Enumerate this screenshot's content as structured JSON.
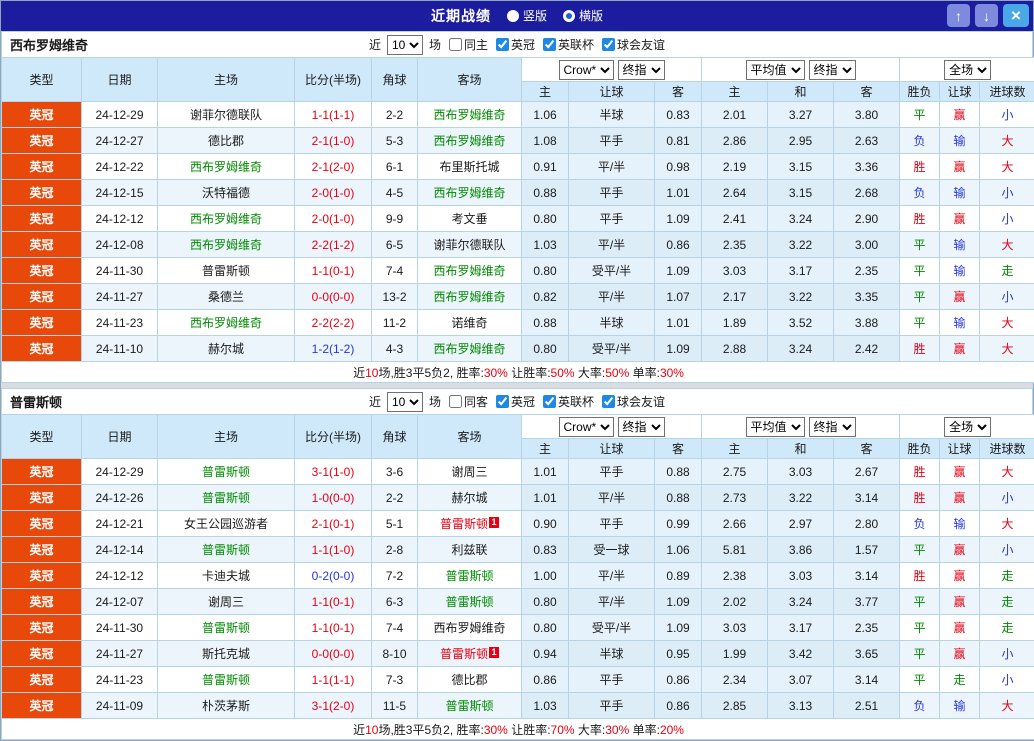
{
  "topbar": {
    "title": "近期战绩",
    "radios": [
      {
        "label": "竖版",
        "checked": false
      },
      {
        "label": "横版",
        "checked": true
      }
    ],
    "up_icon": "↑",
    "down_icon": "↓",
    "close_icon": "×"
  },
  "labels": {
    "near": "近",
    "unit": "场"
  },
  "columns": {
    "type": "类型",
    "date": "日期",
    "home": "主场",
    "score": "比分(半场)",
    "corners": "角球",
    "away": "客场",
    "sub_odds": [
      "主",
      "让球",
      "客"
    ],
    "sub_avg": [
      "主",
      "和",
      "客"
    ],
    "sub_result": [
      "胜负",
      "让球",
      "进球数"
    ]
  },
  "selects": {
    "odds_source": "Crow*",
    "odds_final": "终指",
    "avg_source": "平均值",
    "avg_final": "终指",
    "scope": "全场"
  },
  "colors": {
    "accent_red": "#e60012",
    "accent_green": "#018a01",
    "accent_blue": "#2637d8",
    "league_bg": "#e8490a",
    "header_bg": "#cfe9fa",
    "titlebar_bg": "#1c1c9e"
  },
  "sections": [
    {
      "team": "西布罗姆维奇",
      "filter": {
        "count": "10",
        "checkboxes": [
          {
            "label": "同主",
            "checked": false
          },
          {
            "label": "英冠",
            "checked": true
          },
          {
            "label": "英联杯",
            "checked": true
          },
          {
            "label": "球会友谊",
            "checked": true
          }
        ]
      },
      "rows": [
        {
          "league": "英冠",
          "date": "24-12-29",
          "home": "谢菲尔德联队",
          "home_color": "black",
          "home_badge": "",
          "score": "1-1(1-1)",
          "score_color": "red",
          "corners": "2-2",
          "away": "西布罗姆维奇",
          "away_color": "green",
          "away_badge": "",
          "odds": [
            "1.06",
            "半球",
            "0.83"
          ],
          "avg": [
            "2.01",
            "3.27",
            "3.80"
          ],
          "results": [
            {
              "text": "平",
              "color": "green"
            },
            {
              "text": "赢",
              "color": "red"
            },
            {
              "text": "小",
              "color": "blue"
            }
          ]
        },
        {
          "league": "英冠",
          "date": "24-12-27",
          "home": "德比郡",
          "home_color": "black",
          "home_badge": "",
          "score": "2-1(1-0)",
          "score_color": "red",
          "corners": "5-3",
          "away": "西布罗姆维奇",
          "away_color": "green",
          "away_badge": "",
          "odds": [
            "1.08",
            "平手",
            "0.81"
          ],
          "avg": [
            "2.86",
            "2.95",
            "2.63"
          ],
          "results": [
            {
              "text": "负",
              "color": "blue"
            },
            {
              "text": "输",
              "color": "blue"
            },
            {
              "text": "大",
              "color": "red"
            }
          ]
        },
        {
          "league": "英冠",
          "date": "24-12-22",
          "home": "西布罗姆维奇",
          "home_color": "green",
          "home_badge": "",
          "score": "2-1(2-0)",
          "score_color": "red",
          "corners": "6-1",
          "away": "布里斯托城",
          "away_color": "black",
          "away_badge": "",
          "odds": [
            "0.91",
            "平/半",
            "0.98"
          ],
          "avg": [
            "2.19",
            "3.15",
            "3.36"
          ],
          "results": [
            {
              "text": "胜",
              "color": "red"
            },
            {
              "text": "赢",
              "color": "red"
            },
            {
              "text": "大",
              "color": "red"
            }
          ]
        },
        {
          "league": "英冠",
          "date": "24-12-15",
          "home": "沃特福德",
          "home_color": "black",
          "home_badge": "",
          "score": "2-0(1-0)",
          "score_color": "red",
          "corners": "4-5",
          "away": "西布罗姆维奇",
          "away_color": "green",
          "away_badge": "",
          "odds": [
            "0.88",
            "平手",
            "1.01"
          ],
          "avg": [
            "2.64",
            "3.15",
            "2.68"
          ],
          "results": [
            {
              "text": "负",
              "color": "blue"
            },
            {
              "text": "输",
              "color": "blue"
            },
            {
              "text": "小",
              "color": "blue"
            }
          ]
        },
        {
          "league": "英冠",
          "date": "24-12-12",
          "home": "西布罗姆维奇",
          "home_color": "green",
          "home_badge": "",
          "score": "2-0(1-0)",
          "score_color": "red",
          "corners": "9-9",
          "away": "考文垂",
          "away_color": "black",
          "away_badge": "",
          "odds": [
            "0.80",
            "平手",
            "1.09"
          ],
          "avg": [
            "2.41",
            "3.24",
            "2.90"
          ],
          "results": [
            {
              "text": "胜",
              "color": "red"
            },
            {
              "text": "赢",
              "color": "red"
            },
            {
              "text": "小",
              "color": "blue"
            }
          ]
        },
        {
          "league": "英冠",
          "date": "24-12-08",
          "home": "西布罗姆维奇",
          "home_color": "green",
          "home_badge": "",
          "score": "2-2(1-2)",
          "score_color": "red",
          "corners": "6-5",
          "away": "谢菲尔德联队",
          "away_color": "black",
          "away_badge": "",
          "odds": [
            "1.03",
            "平/半",
            "0.86"
          ],
          "avg": [
            "2.35",
            "3.22",
            "3.00"
          ],
          "results": [
            {
              "text": "平",
              "color": "green"
            },
            {
              "text": "输",
              "color": "blue"
            },
            {
              "text": "大",
              "color": "red"
            }
          ]
        },
        {
          "league": "英冠",
          "date": "24-11-30",
          "home": "普雷斯顿",
          "home_color": "black",
          "home_badge": "",
          "score": "1-1(0-1)",
          "score_color": "red",
          "corners": "7-4",
          "away": "西布罗姆维奇",
          "away_color": "green",
          "away_badge": "",
          "odds": [
            "0.80",
            "受平/半",
            "1.09"
          ],
          "avg": [
            "3.03",
            "3.17",
            "2.35"
          ],
          "results": [
            {
              "text": "平",
              "color": "green"
            },
            {
              "text": "输",
              "color": "blue"
            },
            {
              "text": "走",
              "color": "green"
            }
          ]
        },
        {
          "league": "英冠",
          "date": "24-11-27",
          "home": "桑德兰",
          "home_color": "black",
          "home_badge": "",
          "score": "0-0(0-0)",
          "score_color": "red",
          "corners": "13-2",
          "away": "西布罗姆维奇",
          "away_color": "green",
          "away_badge": "",
          "odds": [
            "0.82",
            "平/半",
            "1.07"
          ],
          "avg": [
            "2.17",
            "3.22",
            "3.35"
          ],
          "results": [
            {
              "text": "平",
              "color": "green"
            },
            {
              "text": "赢",
              "color": "red"
            },
            {
              "text": "小",
              "color": "blue"
            }
          ]
        },
        {
          "league": "英冠",
          "date": "24-11-23",
          "home": "西布罗姆维奇",
          "home_color": "green",
          "home_badge": "",
          "score": "2-2(2-2)",
          "score_color": "red",
          "corners": "11-2",
          "away": "诺维奇",
          "away_color": "black",
          "away_badge": "",
          "odds": [
            "0.88",
            "半球",
            "1.01"
          ],
          "avg": [
            "1.89",
            "3.52",
            "3.88"
          ],
          "results": [
            {
              "text": "平",
              "color": "green"
            },
            {
              "text": "输",
              "color": "blue"
            },
            {
              "text": "大",
              "color": "red"
            }
          ]
        },
        {
          "league": "英冠",
          "date": "24-11-10",
          "home": "赫尔城",
          "home_color": "black",
          "home_badge": "",
          "score": "1-2(1-2)",
          "score_color": "blue",
          "corners": "4-3",
          "away": "西布罗姆维奇",
          "away_color": "green",
          "away_badge": "",
          "odds": [
            "0.80",
            "受平/半",
            "1.09"
          ],
          "avg": [
            "2.88",
            "3.24",
            "2.42"
          ],
          "results": [
            {
              "text": "胜",
              "color": "red"
            },
            {
              "text": "赢",
              "color": "red"
            },
            {
              "text": "大",
              "color": "red"
            }
          ]
        }
      ],
      "summary": [
        {
          "text": "近",
          "color": "black"
        },
        {
          "text": "10",
          "color": "red"
        },
        {
          "text": "场,胜3平5负2, 胜率:",
          "color": "black"
        },
        {
          "text": "30%",
          "color": "red"
        },
        {
          "text": " 让胜率:",
          "color": "black"
        },
        {
          "text": "50%",
          "color": "red"
        },
        {
          "text": " 大率:",
          "color": "black"
        },
        {
          "text": "50%",
          "color": "red"
        },
        {
          "text": " 单率:",
          "color": "black"
        },
        {
          "text": "30%",
          "color": "red"
        }
      ]
    },
    {
      "team": "普雷斯顿",
      "filter": {
        "count": "10",
        "checkboxes": [
          {
            "label": "同客",
            "checked": false
          },
          {
            "label": "英冠",
            "checked": true
          },
          {
            "label": "英联杯",
            "checked": true
          },
          {
            "label": "球会友谊",
            "checked": true
          }
        ]
      },
      "rows": [
        {
          "league": "英冠",
          "date": "24-12-29",
          "home": "普雷斯顿",
          "home_color": "green",
          "home_badge": "",
          "score": "3-1(1-0)",
          "score_color": "red",
          "corners": "3-6",
          "away": "谢周三",
          "away_color": "black",
          "away_badge": "",
          "odds": [
            "1.01",
            "平手",
            "0.88"
          ],
          "avg": [
            "2.75",
            "3.03",
            "2.67"
          ],
          "results": [
            {
              "text": "胜",
              "color": "red"
            },
            {
              "text": "赢",
              "color": "red"
            },
            {
              "text": "大",
              "color": "red"
            }
          ]
        },
        {
          "league": "英冠",
          "date": "24-12-26",
          "home": "普雷斯顿",
          "home_color": "green",
          "home_badge": "",
          "score": "1-0(0-0)",
          "score_color": "red",
          "corners": "2-2",
          "away": "赫尔城",
          "away_color": "black",
          "away_badge": "",
          "odds": [
            "1.01",
            "平/半",
            "0.88"
          ],
          "avg": [
            "2.73",
            "3.22",
            "3.14"
          ],
          "results": [
            {
              "text": "胜",
              "color": "red"
            },
            {
              "text": "赢",
              "color": "red"
            },
            {
              "text": "小",
              "color": "blue"
            }
          ]
        },
        {
          "league": "英冠",
          "date": "24-12-21",
          "home": "女王公园巡游者",
          "home_color": "black",
          "home_badge": "",
          "score": "2-1(0-1)",
          "score_color": "red",
          "corners": "5-1",
          "away": "普雷斯顿",
          "away_color": "red",
          "away_badge": "1",
          "odds": [
            "0.90",
            "平手",
            "0.99"
          ],
          "avg": [
            "2.66",
            "2.97",
            "2.80"
          ],
          "results": [
            {
              "text": "负",
              "color": "blue"
            },
            {
              "text": "输",
              "color": "blue"
            },
            {
              "text": "大",
              "color": "red"
            }
          ]
        },
        {
          "league": "英冠",
          "date": "24-12-14",
          "home": "普雷斯顿",
          "home_color": "green",
          "home_badge": "",
          "score": "1-1(1-0)",
          "score_color": "red",
          "corners": "2-8",
          "away": "利兹联",
          "away_color": "black",
          "away_badge": "",
          "odds": [
            "0.83",
            "受一球",
            "1.06"
          ],
          "avg": [
            "5.81",
            "3.86",
            "1.57"
          ],
          "results": [
            {
              "text": "平",
              "color": "green"
            },
            {
              "text": "赢",
              "color": "red"
            },
            {
              "text": "小",
              "color": "blue"
            }
          ]
        },
        {
          "league": "英冠",
          "date": "24-12-12",
          "home": "卡迪夫城",
          "home_color": "black",
          "home_badge": "",
          "score": "0-2(0-0)",
          "score_color": "blue",
          "corners": "7-2",
          "away": "普雷斯顿",
          "away_color": "green",
          "away_badge": "",
          "odds": [
            "1.00",
            "平/半",
            "0.89"
          ],
          "avg": [
            "2.38",
            "3.03",
            "3.14"
          ],
          "results": [
            {
              "text": "胜",
              "color": "red"
            },
            {
              "text": "赢",
              "color": "red"
            },
            {
              "text": "走",
              "color": "green"
            }
          ]
        },
        {
          "league": "英冠",
          "date": "24-12-07",
          "home": "谢周三",
          "home_color": "black",
          "home_badge": "",
          "score": "1-1(0-1)",
          "score_color": "red",
          "corners": "6-3",
          "away": "普雷斯顿",
          "away_color": "green",
          "away_badge": "",
          "odds": [
            "0.80",
            "平/半",
            "1.09"
          ],
          "avg": [
            "2.02",
            "3.24",
            "3.77"
          ],
          "results": [
            {
              "text": "平",
              "color": "green"
            },
            {
              "text": "赢",
              "color": "red"
            },
            {
              "text": "走",
              "color": "green"
            }
          ]
        },
        {
          "league": "英冠",
          "date": "24-11-30",
          "home": "普雷斯顿",
          "home_color": "green",
          "home_badge": "",
          "score": "1-1(0-1)",
          "score_color": "red",
          "corners": "7-4",
          "away": "西布罗姆维奇",
          "away_color": "black",
          "away_badge": "",
          "odds": [
            "0.80",
            "受平/半",
            "1.09"
          ],
          "avg": [
            "3.03",
            "3.17",
            "2.35"
          ],
          "results": [
            {
              "text": "平",
              "color": "green"
            },
            {
              "text": "赢",
              "color": "red"
            },
            {
              "text": "走",
              "color": "green"
            }
          ]
        },
        {
          "league": "英冠",
          "date": "24-11-27",
          "home": "斯托克城",
          "home_color": "black",
          "home_badge": "",
          "score": "0-0(0-0)",
          "score_color": "red",
          "corners": "8-10",
          "away": "普雷斯顿",
          "away_color": "red",
          "away_badge": "1",
          "odds": [
            "0.94",
            "半球",
            "0.95"
          ],
          "avg": [
            "1.99",
            "3.42",
            "3.65"
          ],
          "results": [
            {
              "text": "平",
              "color": "green"
            },
            {
              "text": "赢",
              "color": "red"
            },
            {
              "text": "小",
              "color": "blue"
            }
          ]
        },
        {
          "league": "英冠",
          "date": "24-11-23",
          "home": "普雷斯顿",
          "home_color": "green",
          "home_badge": "",
          "score": "1-1(1-1)",
          "score_color": "red",
          "corners": "7-3",
          "away": "德比郡",
          "away_color": "black",
          "away_badge": "",
          "odds": [
            "0.86",
            "平手",
            "0.86"
          ],
          "avg": [
            "2.34",
            "3.07",
            "3.14"
          ],
          "results": [
            {
              "text": "平",
              "color": "green"
            },
            {
              "text": "走",
              "color": "green"
            },
            {
              "text": "小",
              "color": "blue"
            }
          ]
        },
        {
          "league": "英冠",
          "date": "24-11-09",
          "home": "朴茨茅斯",
          "home_color": "black",
          "home_badge": "",
          "score": "3-1(2-0)",
          "score_color": "red",
          "corners": "11-5",
          "away": "普雷斯顿",
          "away_color": "green",
          "away_badge": "",
          "odds": [
            "1.03",
            "平手",
            "0.86"
          ],
          "avg": [
            "2.85",
            "3.13",
            "2.51"
          ],
          "results": [
            {
              "text": "负",
              "color": "blue"
            },
            {
              "text": "输",
              "color": "blue"
            },
            {
              "text": "大",
              "color": "red"
            }
          ]
        }
      ],
      "summary": [
        {
          "text": "近",
          "color": "black"
        },
        {
          "text": "10",
          "color": "red"
        },
        {
          "text": "场,胜3平5负2, 胜率:",
          "color": "black"
        },
        {
          "text": "30%",
          "color": "red"
        },
        {
          "text": " 让胜率:",
          "color": "black"
        },
        {
          "text": "70%",
          "color": "red"
        },
        {
          "text": " 大率:",
          "color": "black"
        },
        {
          "text": "30%",
          "color": "red"
        },
        {
          "text": " 单率:",
          "color": "black"
        },
        {
          "text": "20%",
          "color": "red"
        }
      ]
    }
  ]
}
